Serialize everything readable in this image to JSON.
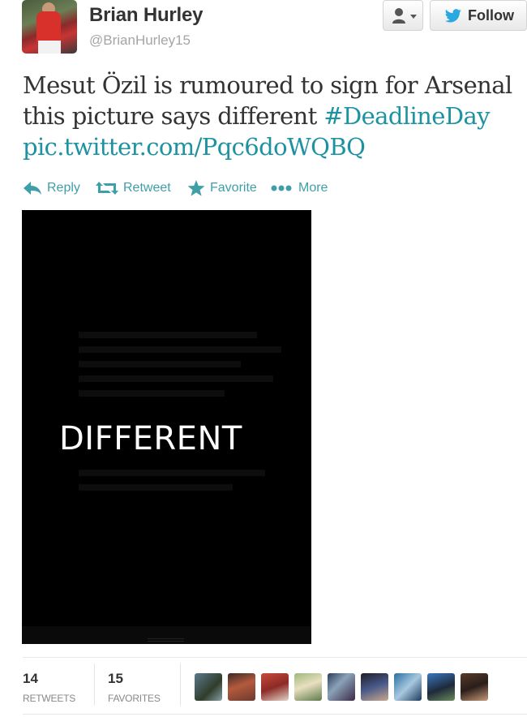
{
  "user": {
    "display_name": "Brian Hurley",
    "screen_name": "@BrianHurley15",
    "avatar_icon": "user-avatar-photo"
  },
  "header_buttons": {
    "user_menu_icon": "person-dropdown-icon",
    "follow_label": "Follow",
    "follow_icon": "twitter-bird-icon"
  },
  "tweet": {
    "line1": "Mesut Özil is rumoured to sign for Arsenal",
    "line2_text": "this picture says different ",
    "hashtag": "#DeadlineDay",
    "pic_link": "pic.twitter.com/Pqc6doWQBQ"
  },
  "actions": [
    {
      "label": "Reply",
      "icon": "reply-arrow-icon"
    },
    {
      "label": "Retweet",
      "icon": "retweet-icon"
    },
    {
      "label": "Favorite",
      "icon": "star-icon"
    },
    {
      "label": "More",
      "icon": "more-dots-icon"
    }
  ],
  "media": {
    "text": "DIFFERENT"
  },
  "stats": {
    "retweets_count": "14",
    "retweets_label": "RETWEETS",
    "favorites_count": "15",
    "favorites_label": "FAVORITES"
  },
  "colors": {
    "link": "#1d92a0",
    "action": "#3f9fa8",
    "follow_bird": "#2aa9e0"
  }
}
